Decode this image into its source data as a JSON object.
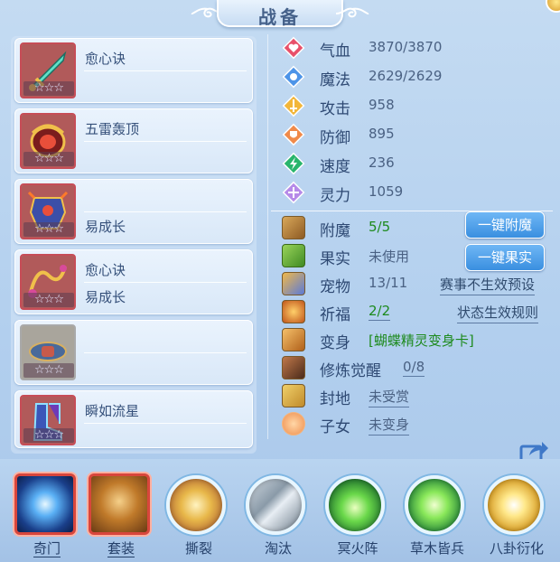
{
  "title": "战备",
  "equipment": [
    {
      "skills": [
        "愈心诀",
        ""
      ],
      "stars": "☆☆☆",
      "icon": "sword-item-icon"
    },
    {
      "skills": [
        "五雷轰顶",
        ""
      ],
      "stars": "☆☆☆",
      "icon": "dragon-orb-item-icon"
    },
    {
      "skills": [
        "",
        "易成长"
      ],
      "stars": "☆☆☆",
      "icon": "armor-item-icon"
    },
    {
      "skills": [
        "愈心诀",
        "易成长"
      ],
      "stars": "☆☆☆",
      "icon": "chain-item-icon"
    },
    {
      "skills": [
        "",
        ""
      ],
      "stars": "☆☆☆",
      "icon": "belt-item-icon"
    },
    {
      "skills": [
        "瞬如流星",
        ""
      ],
      "stars": "☆☆☆",
      "icon": "boots-item-icon"
    }
  ],
  "stats": [
    {
      "label": "气血",
      "value": "3870/3870",
      "icon": "heart-icon",
      "color": "#e8506a"
    },
    {
      "label": "魔法",
      "value": "2629/2629",
      "icon": "mana-icon",
      "color": "#4d94e8"
    },
    {
      "label": "攻击",
      "value": "958",
      "icon": "attack-icon",
      "color": "#f2b63a"
    },
    {
      "label": "防御",
      "value": "895",
      "icon": "defense-icon",
      "color": "#f08a4a"
    },
    {
      "label": "速度",
      "value": "236",
      "icon": "speed-icon",
      "color": "#29b56c"
    },
    {
      "label": "灵力",
      "value": "1059",
      "icon": "spirit-icon",
      "color": "#b68ae8"
    }
  ],
  "extras": [
    {
      "label": "附魔",
      "value": "5/5",
      "icon": "enchant-icon"
    },
    {
      "label": "果实",
      "value": "未使用",
      "icon": "fruit-icon"
    },
    {
      "label": "宠物",
      "value": "13/11",
      "icon": "pet-icon"
    },
    {
      "label": "祈福",
      "value": "2/2",
      "icon": "blessing-icon"
    },
    {
      "label": "变身",
      "value": "[蝴蝶精灵变身卡]",
      "icon": "transform-icon"
    },
    {
      "label": "修炼觉醒",
      "value": "0/8",
      "icon": "cultivation-icon"
    },
    {
      "label": "封地",
      "value": "未受赏",
      "icon": "fief-icon"
    },
    {
      "label": "子女",
      "value": "未变身",
      "icon": "children-icon"
    }
  ],
  "buttons": {
    "enchant": "一键附魔",
    "fruit": "一键果实"
  },
  "links": {
    "pet_preset": "赛事不生效预设",
    "status_rules": "状态生效规则"
  },
  "bottom_skills": [
    {
      "label": "奇门",
      "icon": "qimen-icon",
      "style": "square"
    },
    {
      "label": "套装",
      "icon": "suit-icon",
      "style": "square"
    },
    {
      "label": "撕裂",
      "icon": "tear-icon",
      "style": "circle"
    },
    {
      "label": "淘汰",
      "icon": "eliminate-icon",
      "style": "circle"
    },
    {
      "label": "冥火阵",
      "icon": "nether-fire-icon",
      "style": "circle"
    },
    {
      "label": "草木皆兵",
      "icon": "grass-soldier-icon",
      "style": "circle"
    },
    {
      "label": "八卦衍化",
      "icon": "bagua-icon",
      "style": "circle"
    }
  ]
}
